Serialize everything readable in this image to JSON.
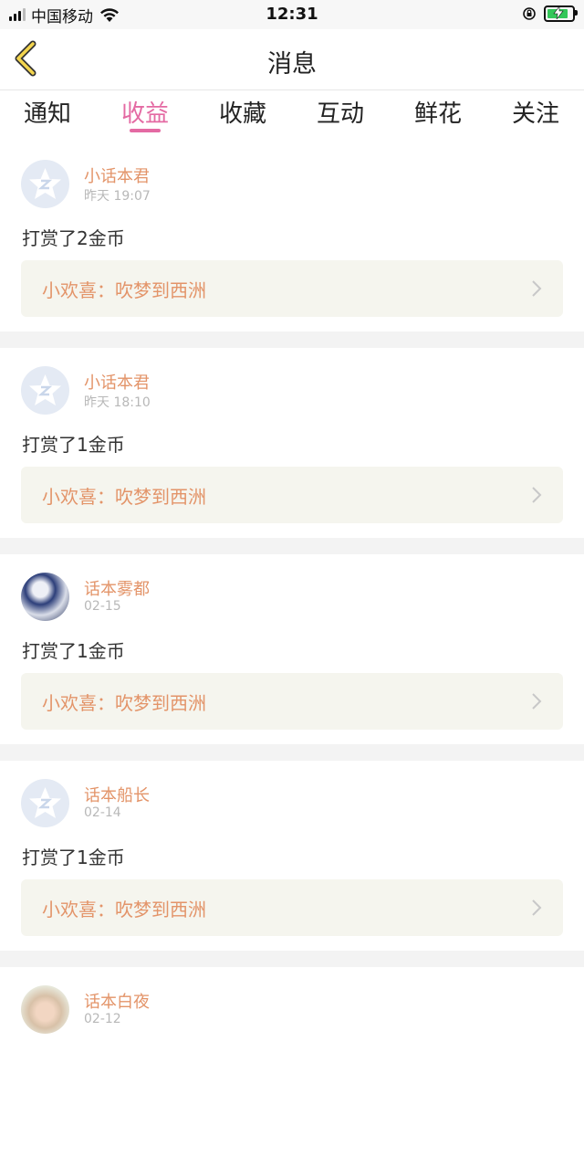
{
  "status_bar": {
    "carrier": "中国移动",
    "time": "12:31"
  },
  "nav": {
    "title": "消息"
  },
  "tabs": [
    {
      "label": "通知"
    },
    {
      "label": "收益"
    },
    {
      "label": "收藏"
    },
    {
      "label": "互动"
    },
    {
      "label": "鲜花"
    },
    {
      "label": "关注"
    }
  ],
  "active_tab": "收益",
  "colors": {
    "accent": "#e46aa3",
    "username": "#e39469",
    "link_bg": "#f5f5ee"
  },
  "messages": [
    {
      "user": "小话本君",
      "time": "昨天 19:07",
      "text": "打赏了2金币",
      "link": "小欢喜：吹梦到西洲",
      "avatar": "default-avatar"
    },
    {
      "user": "小话本君",
      "time": "昨天 18:10",
      "text": "打赏了1金币",
      "link": "小欢喜：吹梦到西洲",
      "avatar": "default-avatar"
    },
    {
      "user": "话本雾都",
      "time": "02-15",
      "text": "打赏了1金币",
      "link": "小欢喜：吹梦到西洲",
      "avatar": "photo-avatar"
    },
    {
      "user": "话本船长",
      "time": "02-14",
      "text": "打赏了1金币",
      "link": "小欢喜：吹梦到西洲",
      "avatar": "default-avatar"
    },
    {
      "user": "话本白夜",
      "time": "02-12",
      "avatar": "photo-avatar"
    }
  ]
}
